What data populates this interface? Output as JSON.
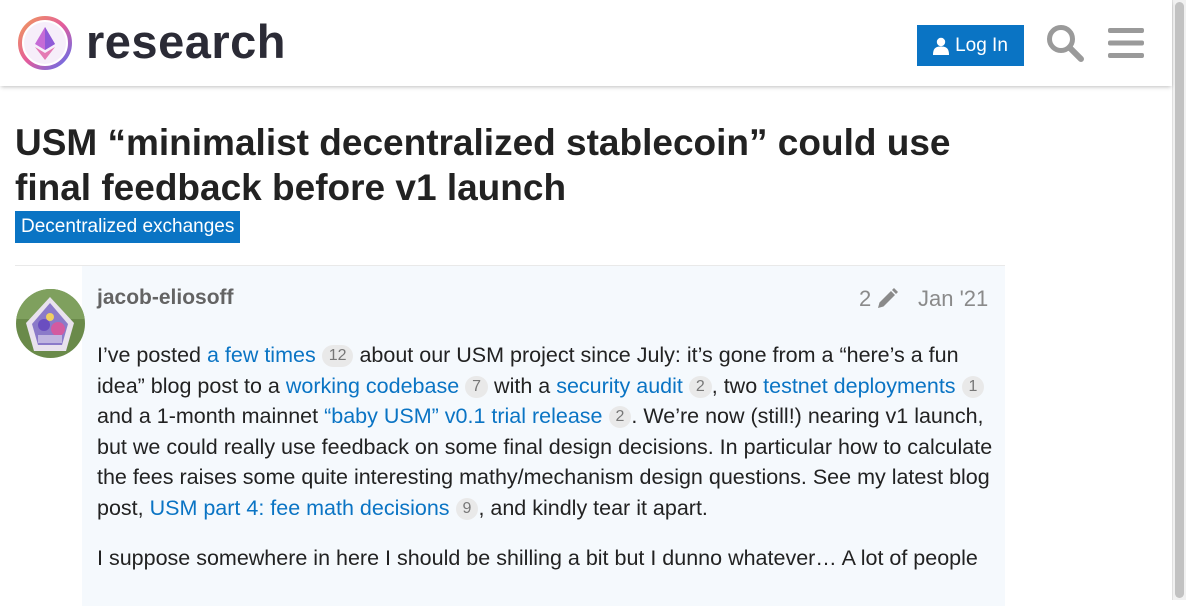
{
  "header": {
    "site_name": "research",
    "login_label": "Log In",
    "colors": {
      "accent": "#0a74c4",
      "logo_ring_a": "#5a6ff0",
      "logo_ring_b": "#e45c9c"
    }
  },
  "topic": {
    "title": "USM “minimalist decentralized stablecoin” could use final feedback before v1 launch",
    "category": "Decentralized exchanges"
  },
  "post": {
    "author": "jacob-eliosoff",
    "edit_count": "2",
    "date": "Jan '21",
    "para1": {
      "t1": "I’ve posted ",
      "link1": "a few times",
      "c1": "12",
      "t2": " about our USM project since July: it’s gone from a “here’s a fun idea” blog post to a ",
      "link2": "working codebase",
      "c2": "7",
      "t3": " with a ",
      "link3": "security audit",
      "c3": "2",
      "t4": ", two ",
      "link4": "testnet deployments",
      "c4": "1",
      "t5": " and a 1-month mainnet ",
      "link5": "“baby USM” v0.1 trial release",
      "c5": "2",
      "t6": ". We’re now (still!) nearing v1 launch, but we could really use feedback on some final design decisions. In particular how to calculate the fees raises some quite interesting mathy/mechanism design questions. See my latest blog post, ",
      "link6": "USM part 4: fee math decisions",
      "c6": "9",
      "t7": ", and kindly tear it apart."
    },
    "para2": "I suppose somewhere in here I should be shilling a bit but I dunno whatever… A lot of people"
  }
}
